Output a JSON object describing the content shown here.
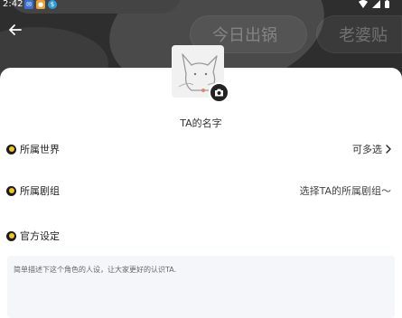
{
  "status_bar": {
    "time": "2:42"
  },
  "header": {
    "chips": [
      "今日出锅",
      "老婆贴"
    ]
  },
  "profile": {
    "name_placeholder": "TA的名字"
  },
  "form": {
    "world_label": "所属世界",
    "world_value": "可多选",
    "group_label": "所属剧组",
    "group_value": "选择TA的所属剧组～",
    "setting_label": "官方设定",
    "setting_placeholder": "简单描述下这个角色的人设，让大家更好的认识TA."
  },
  "colors": {
    "header_bg": "#2e2e2e",
    "bullet_accent": "#f3c61a",
    "input_bg": "#f5f6fa"
  },
  "icons": [
    "back-arrow-icon",
    "camera-icon",
    "chevron-right-icon",
    "wifi-icon",
    "signal-icon",
    "battery-icon"
  ]
}
